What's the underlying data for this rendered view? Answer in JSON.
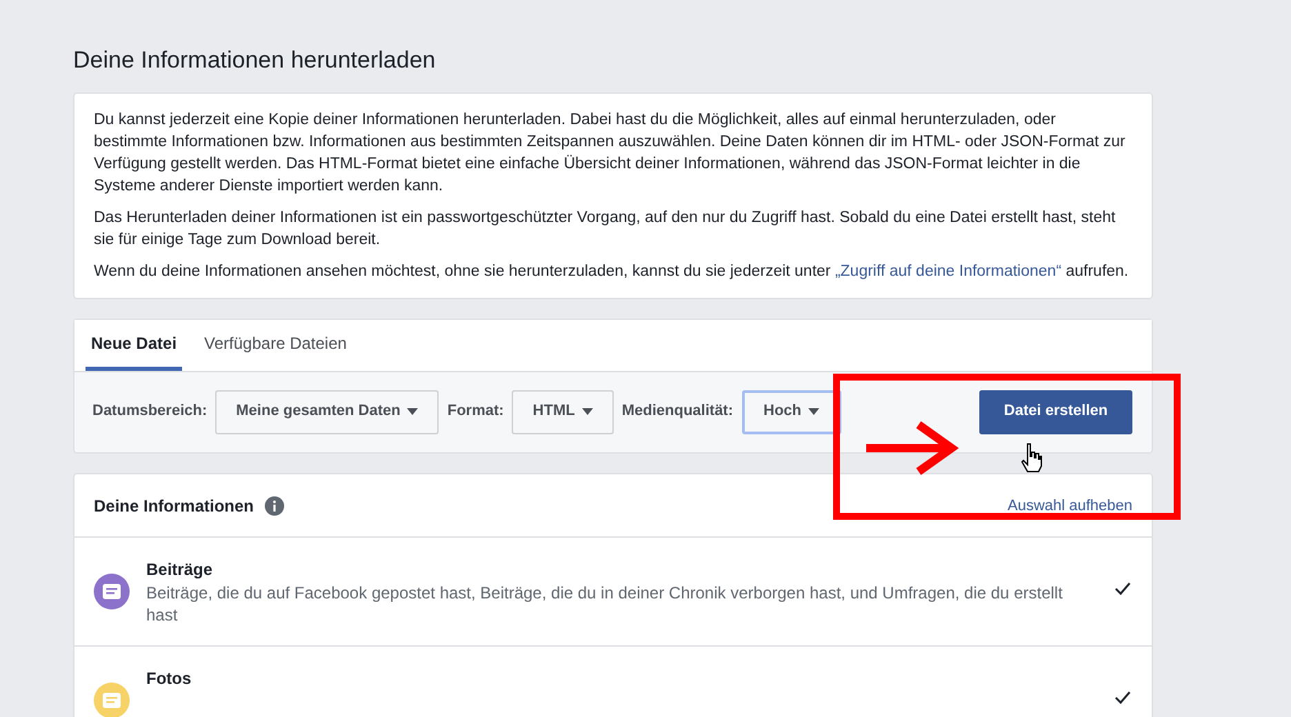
{
  "page_title": "Deine Informationen herunterladen",
  "intro": {
    "paragraphs": [
      "Du kannst jederzeit eine Kopie deiner Informationen herunterladen. Dabei hast du die Möglichkeit, alles auf einmal herunterzuladen, oder bestimmte Informationen bzw. Informationen aus bestimmten Zeitspannen auszuwählen. Deine Daten können dir im HTML- oder JSON-Format zur Verfügung gestellt werden. Das HTML-Format bietet eine einfache Übersicht deiner Informationen, während das JSON-Format leichter in die Systeme anderer Dienste importiert werden kann.",
      "Das Herunterladen deiner Informationen ist ein passwortgeschützter Vorgang, auf den nur du Zugriff hast. Sobald du eine Datei erstellt hast, steht sie für einige Tage zum Download bereit."
    ],
    "link_paragraph": {
      "before": "Wenn du deine Informationen ansehen möchtest, ohne sie herunterzuladen, kannst du sie jederzeit unter ",
      "link": "„Zugriff auf deine Informationen“",
      "after": " aufrufen."
    }
  },
  "tabs": [
    {
      "label": "Neue Datei",
      "selected": true
    },
    {
      "label": "Verfügbare Dateien",
      "selected": false
    }
  ],
  "filters": [
    {
      "label": "Datumsbereich:",
      "value": "Meine gesamten Daten",
      "focused": false
    },
    {
      "label": "Format:",
      "value": "HTML",
      "focused": false
    },
    {
      "label": "Medienqualität:",
      "value": "Hoch",
      "focused": true
    }
  ],
  "create_button": "Datei erstellen",
  "info_section": {
    "title": "Deine Informationen",
    "deselect_link": "Auswahl aufheben",
    "items": [
      {
        "title": "Beiträge",
        "description": "Beiträge, die du auf Facebook gepostet hast, Beiträge, die du in deiner Chronik verborgen hast, und Umfragen, die du erstellt hast",
        "color": "#8c72cb",
        "checked": true
      },
      {
        "title": "Fotos",
        "color": "#f7d367",
        "checked": true
      }
    ]
  }
}
